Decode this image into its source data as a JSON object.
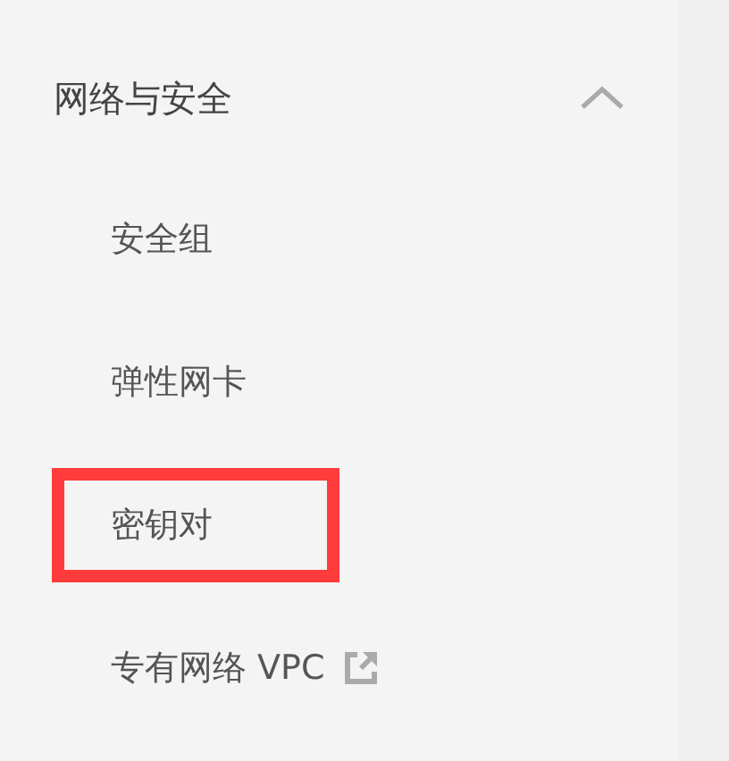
{
  "menu_group": {
    "title": "网络与安全",
    "expanded": true,
    "items": [
      {
        "label": "安全组",
        "highlighted": false,
        "external": false
      },
      {
        "label": "弹性网卡",
        "highlighted": false,
        "external": false
      },
      {
        "label": "密钥对",
        "highlighted": true,
        "external": false
      },
      {
        "label": "专有网络 VPC",
        "highlighted": false,
        "external": true
      }
    ]
  }
}
